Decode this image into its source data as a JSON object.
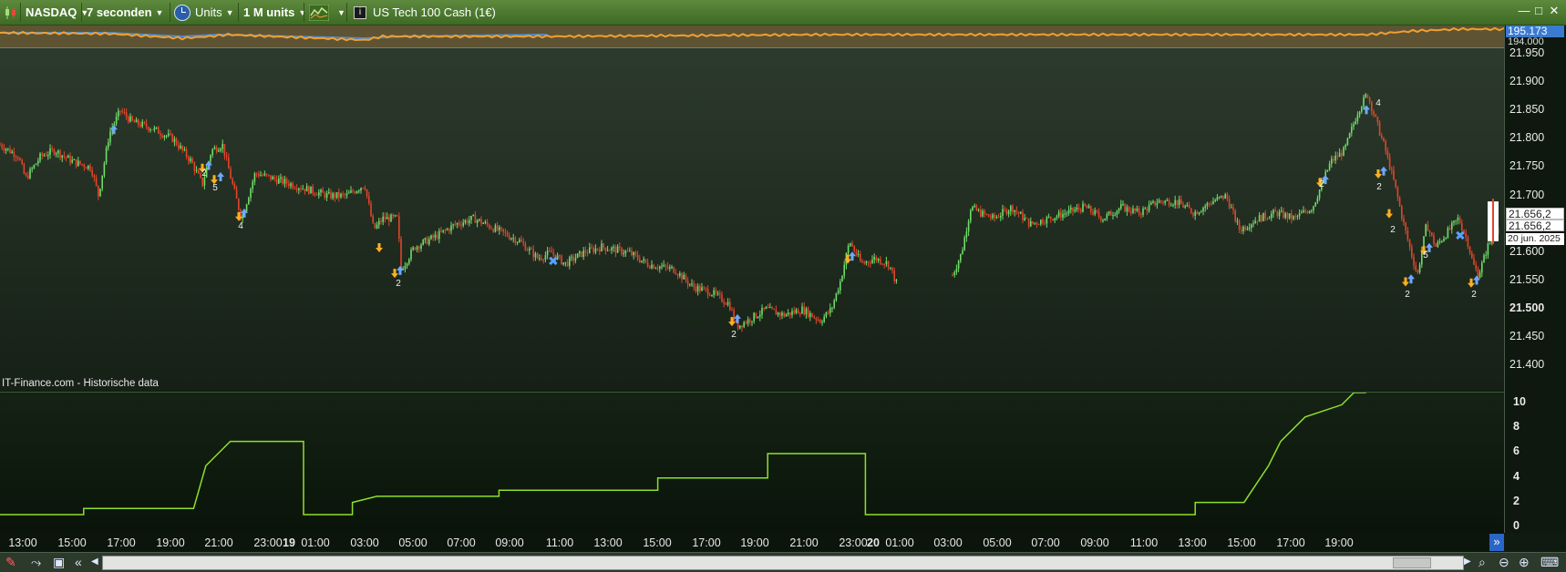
{
  "toolbar": {
    "market": "NASDAQ",
    "interval": "7 seconden",
    "units_label": "Units",
    "size": "1 M units",
    "instrument": "US Tech 100 Cash (1€)"
  },
  "top_panel": {
    "value_1": "195.173",
    "value_2": "194.000"
  },
  "main_axis": {
    "labels": [
      "21.950",
      "21.900",
      "21.850",
      "21.800",
      "21.750",
      "21.700",
      "21.650",
      "21.600",
      "21.550",
      "21.500",
      "21.450",
      "21.400"
    ],
    "bold_labels": [
      "21.500"
    ],
    "price_1": "21.656,2",
    "price_2": "21.656,2",
    "date_tag": "20 jun. 2025"
  },
  "source_label": "IT-Finance.com - Historische data",
  "osc_axis": {
    "labels": [
      "10",
      "8",
      "6",
      "4",
      "2",
      "0"
    ]
  },
  "time_axis": {
    "labels": [
      {
        "t": "13:00",
        "x": 25
      },
      {
        "t": "15:00",
        "x": 79
      },
      {
        "t": "17:00",
        "x": 133
      },
      {
        "t": "19:00",
        "x": 187
      },
      {
        "t": "21:00",
        "x": 240
      },
      {
        "t": "23:00",
        "x": 294
      },
      {
        "t": "19",
        "x": 317,
        "bold": true
      },
      {
        "t": "01:00",
        "x": 346
      },
      {
        "t": "03:00",
        "x": 400
      },
      {
        "t": "05:00",
        "x": 453
      },
      {
        "t": "07:00",
        "x": 506
      },
      {
        "t": "09:00",
        "x": 559
      },
      {
        "t": "11:00",
        "x": 614
      },
      {
        "t": "13:00",
        "x": 667
      },
      {
        "t": "15:00",
        "x": 721
      },
      {
        "t": "17:00",
        "x": 775
      },
      {
        "t": "19:00",
        "x": 828
      },
      {
        "t": "21:00",
        "x": 882
      },
      {
        "t": "23:00",
        "x": 936
      },
      {
        "t": "20",
        "x": 958,
        "bold": true
      },
      {
        "t": "01:00",
        "x": 987
      },
      {
        "t": "03:00",
        "x": 1040
      },
      {
        "t": "05:00",
        "x": 1094
      },
      {
        "t": "07:00",
        "x": 1147
      },
      {
        "t": "09:00",
        "x": 1201
      },
      {
        "t": "11:00",
        "x": 1255
      },
      {
        "t": "13:00",
        "x": 1308
      },
      {
        "t": "15:00",
        "x": 1362
      },
      {
        "t": "17:00",
        "x": 1416
      },
      {
        "t": "19:00",
        "x": 1469
      }
    ]
  },
  "trade_labels": [
    {
      "t": "2"
    },
    {
      "t": "5"
    },
    {
      "t": "4"
    },
    {
      "t": "2"
    },
    {
      "t": "2"
    },
    {
      "t": "2"
    },
    {
      "t": "4"
    },
    {
      "t": "2"
    },
    {
      "t": "2"
    },
    {
      "t": "5"
    },
    {
      "t": "2"
    },
    {
      "t": "2"
    }
  ],
  "chart_data": {
    "type": "line",
    "main": {
      "x_hours": [
        "12:30",
        "13:30",
        "14:30",
        "15:30",
        "16:30",
        "17:00",
        "18:00",
        "19:00",
        "20:00",
        "20:30",
        "21:00",
        "22:00",
        "23:00",
        "00:00",
        "01:00",
        "02:00",
        "02:30",
        "03:00",
        "04:00",
        "05:00",
        "06:00",
        "07:00",
        "08:00",
        "09:00",
        "10:00",
        "11:00",
        "12:00",
        "13:00",
        "14:00",
        "15:00",
        "15:30",
        "16:00",
        "17:00",
        "18:00",
        "19:00",
        "20:00",
        "20:30",
        "21:00",
        "22:00",
        "23:00",
        "00:00",
        "01:00",
        "02:00",
        "03:00",
        "04:00",
        "05:00",
        "06:00",
        "07:00",
        "08:00",
        "09:00",
        "10:00",
        "11:00",
        "12:00",
        "13:00",
        "14:00",
        "15:00",
        "15:30",
        "16:00",
        "16:30",
        "17:00",
        "18:00",
        "19:00",
        "19:30",
        "20:00"
      ],
      "y_range": [
        21380,
        21950
      ]
    },
    "oscillator": {
      "y_range": [
        -1,
        10.5
      ],
      "series": [
        {
          "x": "12:30",
          "y": 0
        },
        {
          "x": "16:00",
          "y": 0
        },
        {
          "x": "16:00",
          "y": 0.5
        },
        {
          "x": "20:30",
          "y": 0.5
        },
        {
          "x": "21:00",
          "y": 4
        },
        {
          "x": "21:30",
          "y": 5
        },
        {
          "x": "22:00",
          "y": 6
        },
        {
          "x": "01:00",
          "y": 6
        },
        {
          "x": "01:00",
          "y": 0
        },
        {
          "x": "03:00",
          "y": 0
        },
        {
          "x": "03:00",
          "y": 1
        },
        {
          "x": "04:00",
          "y": 1.5
        },
        {
          "x": "09:00",
          "y": 1.5
        },
        {
          "x": "09:00",
          "y": 2
        },
        {
          "x": "15:30",
          "y": 2
        },
        {
          "x": "15:30",
          "y": 3
        },
        {
          "x": "20:00",
          "y": 3
        },
        {
          "x": "20:00",
          "y": 5
        },
        {
          "x": "00:00",
          "y": 5
        },
        {
          "x": "00:00",
          "y": 0
        },
        {
          "x": "13:30",
          "y": 0
        },
        {
          "x": "13:30",
          "y": 1
        },
        {
          "x": "15:30",
          "y": 1
        },
        {
          "x": "16:30",
          "y": 4
        },
        {
          "x": "17:00",
          "y": 6
        },
        {
          "x": "18:00",
          "y": 8
        },
        {
          "x": "19:30",
          "y": 9
        },
        {
          "x": "20:00",
          "y": 10
        },
        {
          "x": "20:30",
          "y": 10
        }
      ]
    }
  }
}
